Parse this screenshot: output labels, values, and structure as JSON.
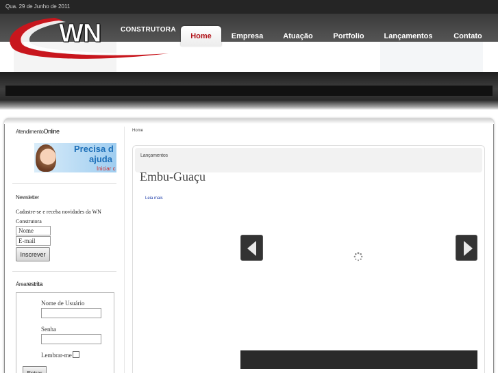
{
  "header": {
    "date": "Qua. 29 de Junho de 2011",
    "logo_text": "WN",
    "logo_sub": "CONSTRUTORA",
    "accent": "#c8161d"
  },
  "nav": {
    "items": [
      {
        "label": "Home",
        "active": true
      },
      {
        "label": "Empresa",
        "active": false
      },
      {
        "label": "Atuação",
        "active": false
      },
      {
        "label": "Portfolio",
        "active": false
      },
      {
        "label": "Lançamentos",
        "active": false
      },
      {
        "label": "Contato",
        "active": false
      }
    ]
  },
  "sidebar": {
    "online": {
      "title_a": "Atendimento",
      "title_b": "Online"
    },
    "help_banner": {
      "line1": "Precisa d",
      "line2": "ajuda",
      "line3": "Iniciar c"
    },
    "newsletter": {
      "title": "Newsletter",
      "text": "Cadastre-se e receba novidades da WN Construtora",
      "name_value": "Nome",
      "email_value": "E-mail",
      "submit_label": "Inscrever"
    },
    "restricted": {
      "title_a": "Área",
      "title_b": "restrita",
      "user_label": "Nome de Usuário",
      "password_label": "Senha",
      "remember_label": "Lembrar-me",
      "enter_label": "Entrar"
    }
  },
  "main": {
    "breadcrumb": "Home",
    "section_label": "Lançamentos",
    "city": "Embu-Guaçu",
    "read_more": "Leia mais"
  },
  "icons": {
    "prev": "arrow-left-icon",
    "next": "arrow-right-icon",
    "loading": "spinner-icon"
  }
}
